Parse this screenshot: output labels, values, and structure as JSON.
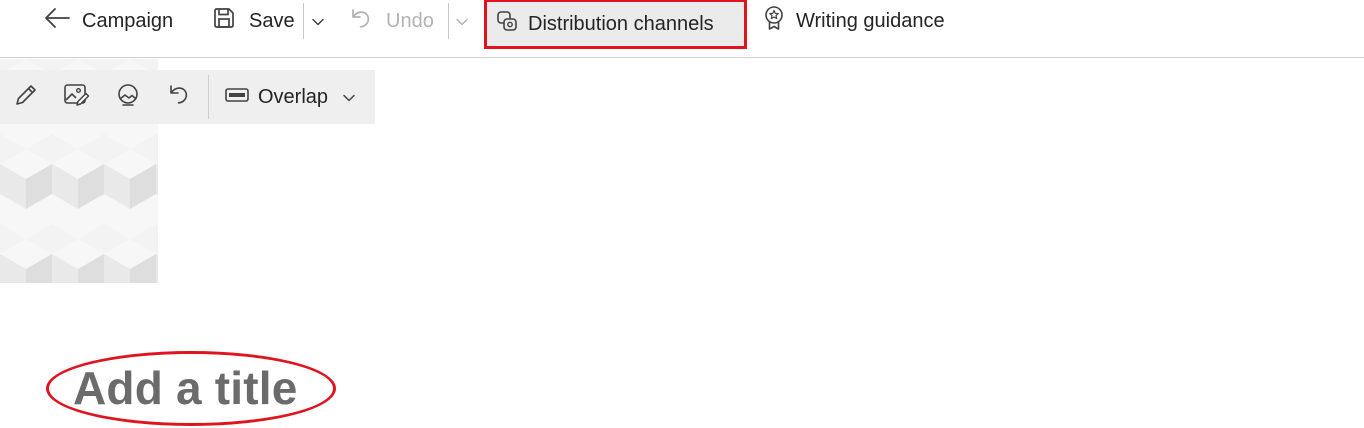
{
  "command_bar": {
    "back": {
      "label": "Campaign",
      "icon": "arrow-left-icon"
    },
    "save": {
      "label": "Save",
      "icon": "save-icon"
    },
    "save_dropdown": {
      "icon": "chevron-down-icon"
    },
    "undo": {
      "label": "Undo",
      "icon": "undo-icon",
      "disabled": true
    },
    "undo_dropdown": {
      "icon": "chevron-down-icon",
      "disabled": true
    },
    "distribution": {
      "label": "Distribution channels",
      "icon": "distribution-icon",
      "highlighted": true
    },
    "guidance": {
      "label": "Writing guidance",
      "icon": "ribbon-award-icon"
    }
  },
  "image_toolbar": {
    "buttons": [
      {
        "name": "edit",
        "icon": "pencil-icon"
      },
      {
        "name": "change-image",
        "icon": "image-edit-icon"
      },
      {
        "name": "focal-point",
        "icon": "image-focus-icon"
      },
      {
        "name": "reset",
        "icon": "undo-icon"
      }
    ],
    "layout": {
      "label": "Overlap",
      "icon": "layout-banner-icon"
    }
  },
  "title": {
    "placeholder": "Add a title",
    "circled": true
  },
  "colors": {
    "highlight_red": "#e0141e",
    "text": "#242424",
    "disabled_text": "#b3b3b3",
    "title_placeholder": "#6b6b6b"
  }
}
